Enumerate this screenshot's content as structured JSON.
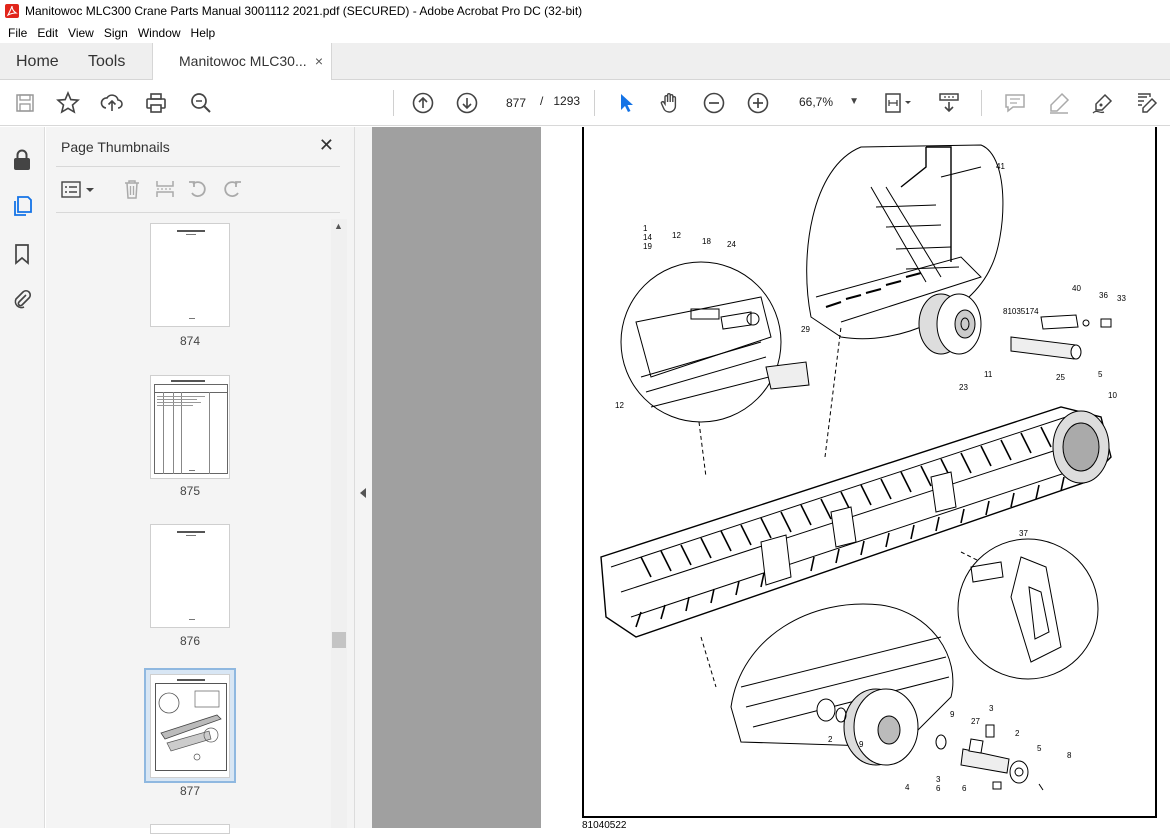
{
  "window": {
    "title": "Manitowoc MLC300 Crane Parts Manual 3001112 2021.pdf (SECURED) - Adobe Acrobat Pro DC (32-bit)"
  },
  "menu": [
    "File",
    "Edit",
    "View",
    "Sign",
    "Window",
    "Help"
  ],
  "tabs": {
    "home": "Home",
    "tools": "Tools",
    "document": "Manitowoc MLC30...",
    "close": "×"
  },
  "toolbar": {
    "current_page": "877",
    "page_separator": "/",
    "total_pages": "1293",
    "zoom": "66,7%"
  },
  "thumbnails_panel": {
    "title": "Page Thumbnails",
    "close": "✕",
    "pages": [
      {
        "label": "874"
      },
      {
        "label": "875"
      },
      {
        "label": "876"
      },
      {
        "label": "877",
        "selected": true
      }
    ]
  },
  "drawing": {
    "callouts": [
      "1",
      "14",
      "19",
      "12",
      "18",
      "24",
      "41",
      "40",
      "36",
      "33",
      "81035174",
      "29",
      "11",
      "25",
      "5",
      "12",
      "23",
      "10",
      "37",
      "2",
      "9",
      "9",
      "3",
      "27",
      "2",
      "5",
      "8",
      "4",
      "3",
      "6",
      "6"
    ],
    "footer_code": "81040522"
  },
  "colors": {
    "accent": "#1473e6",
    "doc_background": "#a0a0a0",
    "panel_background": "#f4f4f4"
  }
}
